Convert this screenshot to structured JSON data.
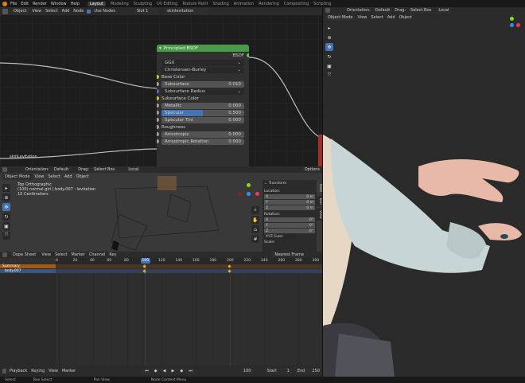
{
  "topbar": {
    "menus": [
      "File",
      "Edit",
      "Render",
      "Window",
      "Help"
    ],
    "workspaces": [
      "Layout",
      "Modeling",
      "Sculpting",
      "UV Editing",
      "Texture Paint",
      "Shading",
      "Animation",
      "Rendering",
      "Compositing",
      "Scripting"
    ],
    "active_workspace": "Layout"
  },
  "node_editor": {
    "mode": "Object",
    "menus": [
      "View",
      "Select",
      "Add",
      "Node"
    ],
    "use_nodes_label": "Use Nodes",
    "slot": "Slot 1",
    "material": "skinlevitation",
    "left_label": "skinLevitation",
    "node": {
      "title": "Principled BSDF",
      "output": "BSDF",
      "distribution": "GGX",
      "subsurface_method": "Christensen-Burley",
      "base_color": "Base Color",
      "subsurface": {
        "label": "Subsurface",
        "value": "0.010"
      },
      "subsurface_radius": "Subsurface Radius",
      "subsurface_color": "Subsurface Color",
      "metallic": {
        "label": "Metallic",
        "value": "0.000"
      },
      "specular": {
        "label": "Specular",
        "value": "0.500"
      },
      "specular_tint": {
        "label": "Specular Tint",
        "value": "0.000"
      },
      "roughness": "Roughness",
      "anisotropic": {
        "label": "Anisotropic",
        "value": "0.000"
      },
      "anisotropic_rotation": {
        "label": "Anisotropic Rotation",
        "value": "0.000"
      }
    }
  },
  "viewport_small": {
    "orientation_label": "Orientation:",
    "orientation": "Default",
    "drag": "Drag:",
    "drag_value": "Select Box",
    "local": "Local",
    "options": "Options",
    "mode": "Object Mode",
    "menus": [
      "View",
      "Select",
      "Add",
      "Object"
    ],
    "info_lines": [
      "Top Orthographic",
      "(100) normal.girl | body.007 : levitation",
      "10 Centimeters"
    ],
    "n_panel": {
      "title": "Transform",
      "location": "Location:",
      "rotation": "Rotation:",
      "scale": "Scale:",
      "axes": [
        "X",
        "Y",
        "Z"
      ],
      "loc_values": [
        "0 m",
        "0 m",
        "0 m"
      ],
      "rot_values": [
        "0°",
        "0°",
        "0°"
      ],
      "rot_mode": "XYZ Euler",
      "tabs": [
        "Item",
        "Tool",
        "View"
      ]
    }
  },
  "dope_sheet": {
    "editor": "Dope Sheet",
    "menus": [
      "View",
      "Select",
      "Marker",
      "Channel",
      "Key"
    ],
    "snap": "Nearest Frame",
    "ticks": [
      "0",
      "20",
      "40",
      "60",
      "80",
      "100",
      "120",
      "140",
      "160",
      "180",
      "200",
      "220",
      "240",
      "260",
      "280",
      "300"
    ],
    "current_frame": "100",
    "channels": [
      "Summary",
      "body.007"
    ]
  },
  "timeline": {
    "menus": [
      "Playback",
      "Keying",
      "View",
      "Marker"
    ],
    "frame": "100",
    "start_label": "Start",
    "start": "1",
    "end_label": "End",
    "end": "250"
  },
  "statusbar": {
    "items": [
      "Select",
      "Box Select",
      "Pan View",
      "Node Context Menu"
    ]
  },
  "viewport_right": {
    "mode": "Object Mode",
    "menus": [
      "View",
      "Select",
      "Add",
      "Object"
    ],
    "orientation_label": "Orientation:",
    "orientation": "Default",
    "drag": "Drag:",
    "drag_value": "Select Box",
    "local": "Local"
  },
  "colors": {
    "accent": "#4772b3",
    "node_header": "#4a9a4c",
    "socket_yellow": "#c7c729",
    "socket_grey": "#a1a1a1",
    "socket_purple": "#6363c7",
    "socket_green": "#63c763",
    "playhead": "#4772b3"
  }
}
